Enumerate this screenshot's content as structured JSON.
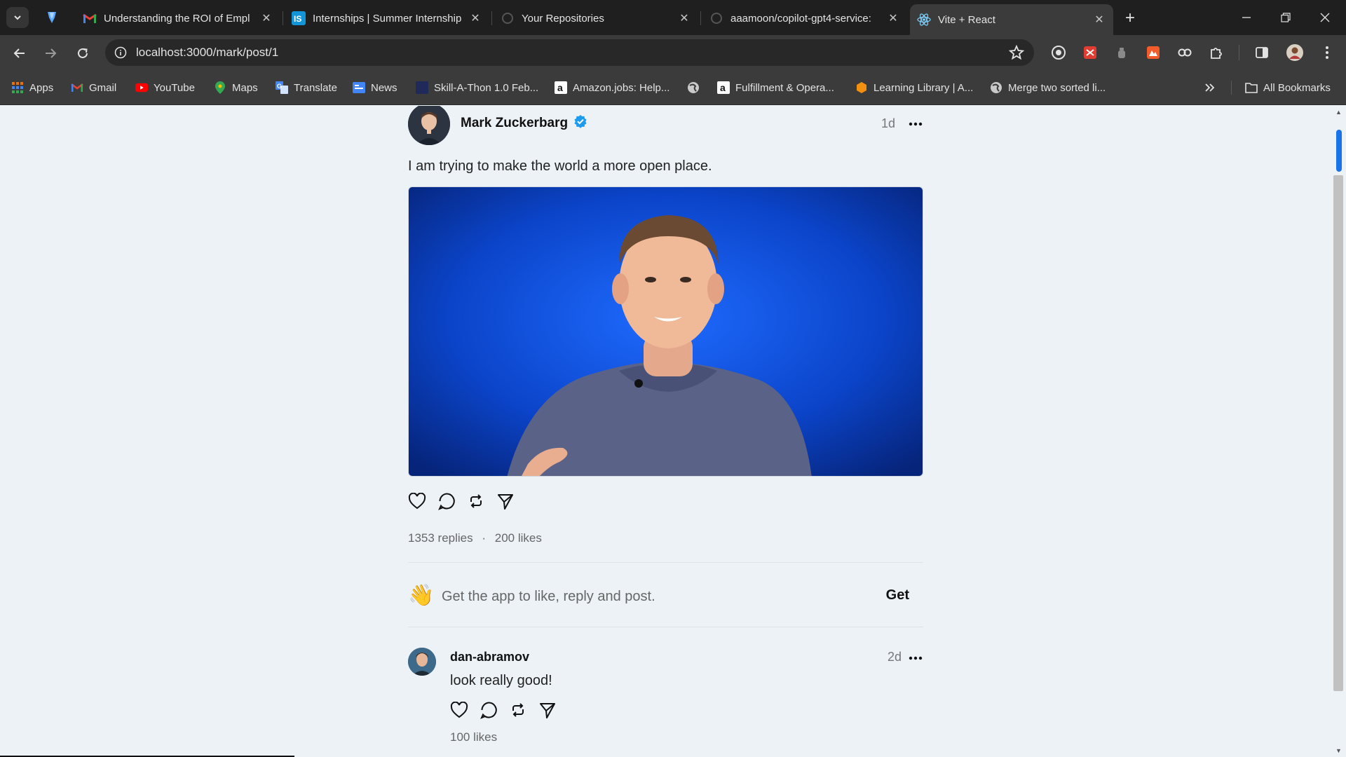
{
  "browser": {
    "tabs": [
      {
        "title": "Understanding the ROI of Empl",
        "icon": "gmail-icon"
      },
      {
        "title": "Internships | Summer Internship",
        "icon": "internshala-icon"
      },
      {
        "title": "Your Repositories",
        "icon": "github-icon"
      },
      {
        "title": "aaamoon/copilot-gpt4-service:",
        "icon": "github-icon"
      },
      {
        "title": "Vite + React",
        "icon": "react-icon",
        "active": true
      }
    ],
    "url": "localhost:3000/mark/post/1",
    "bookmarks": [
      {
        "label": "Apps",
        "icon": "apps-grid-icon"
      },
      {
        "label": "Gmail",
        "icon": "gmail-icon"
      },
      {
        "label": "YouTube",
        "icon": "youtube-icon"
      },
      {
        "label": "Maps",
        "icon": "maps-icon"
      },
      {
        "label": "Translate",
        "icon": "translate-icon"
      },
      {
        "label": "News",
        "icon": "news-icon"
      },
      {
        "label": "Skill-A-Thon 1.0 Feb...",
        "icon": "site-icon"
      },
      {
        "label": "Amazon.jobs: Help...",
        "icon": "amazon-icon"
      },
      {
        "label": "",
        "icon": "globe-icon"
      },
      {
        "label": "Fulfillment & Opera...",
        "icon": "amazon-icon"
      },
      {
        "label": "Learning Library | A...",
        "icon": "aws-icon"
      },
      {
        "label": "Merge two sorted li...",
        "icon": "globe-icon"
      }
    ],
    "all_bookmarks": "All Bookmarks"
  },
  "post": {
    "author": "Mark Zuckerbarg",
    "time": "1d",
    "text": "I am trying to make the world a more open place.",
    "replies": "1353 replies",
    "dot": "·",
    "likes": "200 likes"
  },
  "get_app": {
    "emoji": "👋",
    "message": "Get the app to like, reply and post.",
    "button": "Get"
  },
  "reply": {
    "user": "dan-abramov",
    "time": "2d",
    "text": "look really good!",
    "likes": "100 likes"
  },
  "colors": {
    "accent": "#1a73e8",
    "verified": "#1d9bf0",
    "page_bg": "#edf2f7",
    "chrome_bg": "#3b3b3b",
    "tabbar_bg": "#1f1f1f"
  }
}
